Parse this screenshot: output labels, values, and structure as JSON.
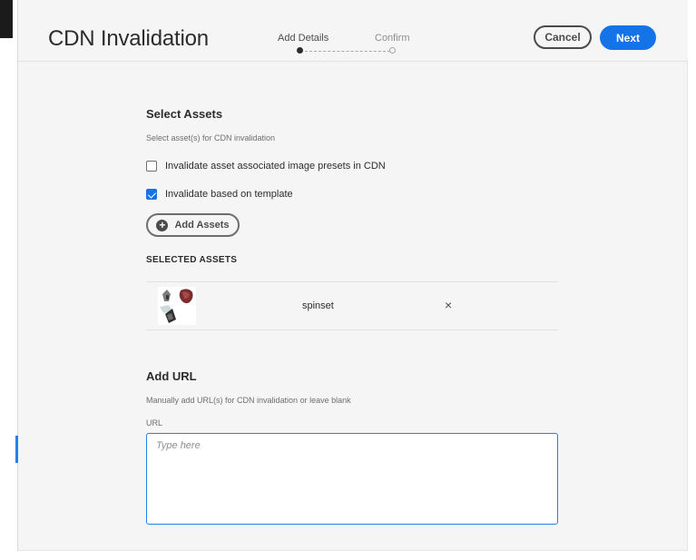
{
  "header": {
    "title": "CDN Invalidation",
    "steps": [
      "Add Details",
      "Confirm"
    ],
    "cancel_label": "Cancel",
    "next_label": "Next"
  },
  "select_assets": {
    "title": "Select Assets",
    "subtitle": "Select asset(s) for CDN invalidation",
    "options": [
      {
        "label": "Invalidate asset associated image presets in CDN",
        "checked": false
      },
      {
        "label": "Invalidate based on template",
        "checked": true
      }
    ],
    "add_button_label": "Add Assets",
    "selected_heading": "SELECTED ASSETS",
    "assets": [
      {
        "name": "spinset",
        "remove_icon": "×"
      }
    ]
  },
  "add_url": {
    "title": "Add URL",
    "subtitle": "Manually add URL(s) for CDN invalidation or leave blank",
    "field_label": "URL",
    "placeholder": "Type here",
    "value": ""
  },
  "colors": {
    "accent": "#1473e6",
    "focus_border": "#2680eb",
    "background": "#f5f5f5"
  },
  "icons": {
    "add": "plus-circle-icon",
    "remove": "close-icon",
    "checkbox": "checkmark-icon"
  }
}
